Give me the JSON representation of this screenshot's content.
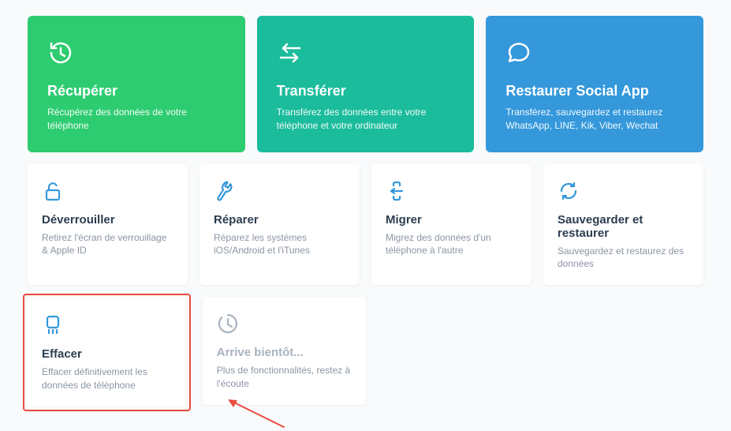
{
  "colors": {
    "green": "#2ecc71",
    "teal": "#1abc9c",
    "blue": "#3498db",
    "iconBlue": "#3498db",
    "red": "#e84a3d",
    "gray": "#aab3bd"
  },
  "topCards": [
    {
      "id": "recover",
      "title": "Récupérer",
      "desc": "Récupérez des données de votre téléphone",
      "icon": "recover-icon"
    },
    {
      "id": "transfer",
      "title": "Transférer",
      "desc": "Transférez des données entre votre téléphone et votre ordinateur",
      "icon": "transfer-icon"
    },
    {
      "id": "social",
      "title": "Restaurer Social App",
      "desc": "Transférez, sauvegardez et restaurez WhatsApp, LINE, Kik, Viber, Wechat",
      "icon": "chat-icon"
    }
  ],
  "midCards": [
    {
      "id": "unlock",
      "title": "Déverrouiller",
      "desc": "Retirez l'écran de verrouillage & Apple ID",
      "icon": "unlock-icon"
    },
    {
      "id": "repair",
      "title": "Réparer",
      "desc": "Réparez les systèmes iOS/Android et l'iTunes",
      "icon": "wrench-icon"
    },
    {
      "id": "migrate",
      "title": "Migrer",
      "desc": "Migrez des données d'un téléphone à l'autre",
      "icon": "migrate-icon"
    },
    {
      "id": "backup",
      "title": "Sauvegarder et restaurer",
      "desc": "Sauvegardez et restaurez des données",
      "icon": "sync-icon"
    }
  ],
  "eraseCard": {
    "title": "Effacer",
    "desc": "Effacer définitivement les données de téléphone",
    "icon": "erase-icon"
  },
  "comingSoon": {
    "title": "Arrive bientôt...",
    "desc": "Plus de fonctionnalités, restez à l'écoute",
    "icon": "clock-icon"
  }
}
